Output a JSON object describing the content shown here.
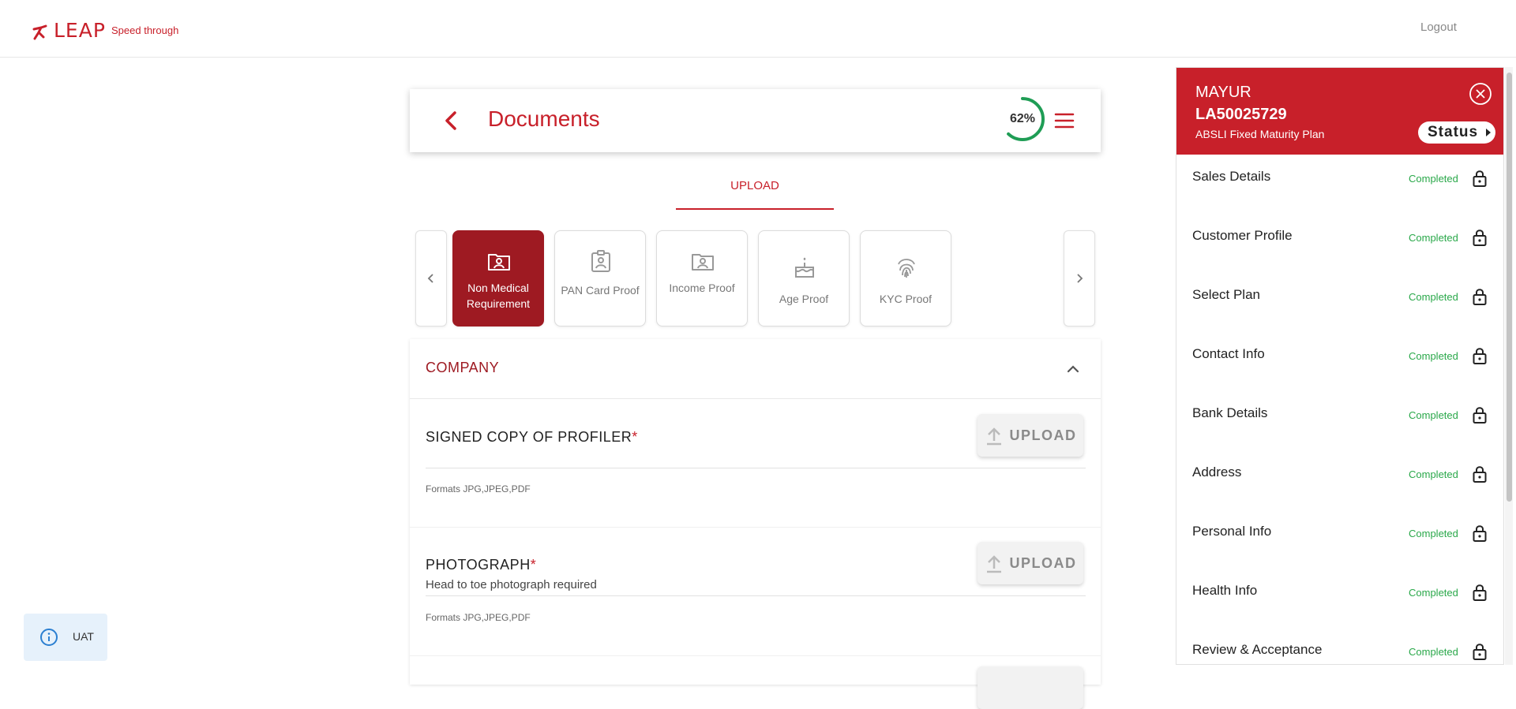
{
  "header": {
    "logo_text": "LEAP",
    "tagline": "Speed through",
    "logout_label": "Logout"
  },
  "documents": {
    "title": "Documents",
    "progress_text": "62%",
    "progress_value": 62,
    "tab_label": "UPLOAD"
  },
  "categories": [
    {
      "label": "Non Medical Requirement",
      "icon": "folder-user-icon",
      "active": true
    },
    {
      "label": "PAN Card Proof",
      "icon": "id-badge-icon",
      "active": false
    },
    {
      "label": "Income Proof",
      "icon": "folder-user-icon",
      "active": false
    },
    {
      "label": "Age Proof",
      "icon": "cake-icon",
      "active": false
    },
    {
      "label": "KYC Proof",
      "icon": "fingerprint-icon",
      "active": false
    }
  ],
  "section": {
    "title": "COMPANY",
    "items": [
      {
        "name": "SIGNED COPY OF PROFILER",
        "required_mark": "*",
        "subtitle": "",
        "formats": "Formats JPG,JPEG,PDF",
        "upload_label": "UPLOAD"
      },
      {
        "name": "PHOTOGRAPH",
        "required_mark": "*",
        "subtitle": "Head to toe photograph required",
        "formats": "Formats JPG,JPEG,PDF",
        "upload_label": "UPLOAD"
      }
    ]
  },
  "env_badge": {
    "label": "UAT"
  },
  "panel": {
    "name": "MAYUR",
    "app_id": "LA50025729",
    "plan": "ABSLI Fixed Maturity Plan",
    "status_label": "Status",
    "steps": [
      {
        "label": "Sales Details",
        "status": "Completed"
      },
      {
        "label": "Customer Profile",
        "status": "Completed"
      },
      {
        "label": "Select Plan",
        "status": "Completed"
      },
      {
        "label": "Contact Info",
        "status": "Completed"
      },
      {
        "label": "Bank Details",
        "status": "Completed"
      },
      {
        "label": "Address",
        "status": "Completed"
      },
      {
        "label": "Personal Info",
        "status": "Completed"
      },
      {
        "label": "Health Info",
        "status": "Completed"
      },
      {
        "label": "Review & Acceptance",
        "status": "Completed"
      }
    ]
  },
  "colors": {
    "brand": "#c8202a",
    "active_card": "#9e1a22",
    "completed": "#2aa84a",
    "progress_ring": "#1f9d55"
  }
}
